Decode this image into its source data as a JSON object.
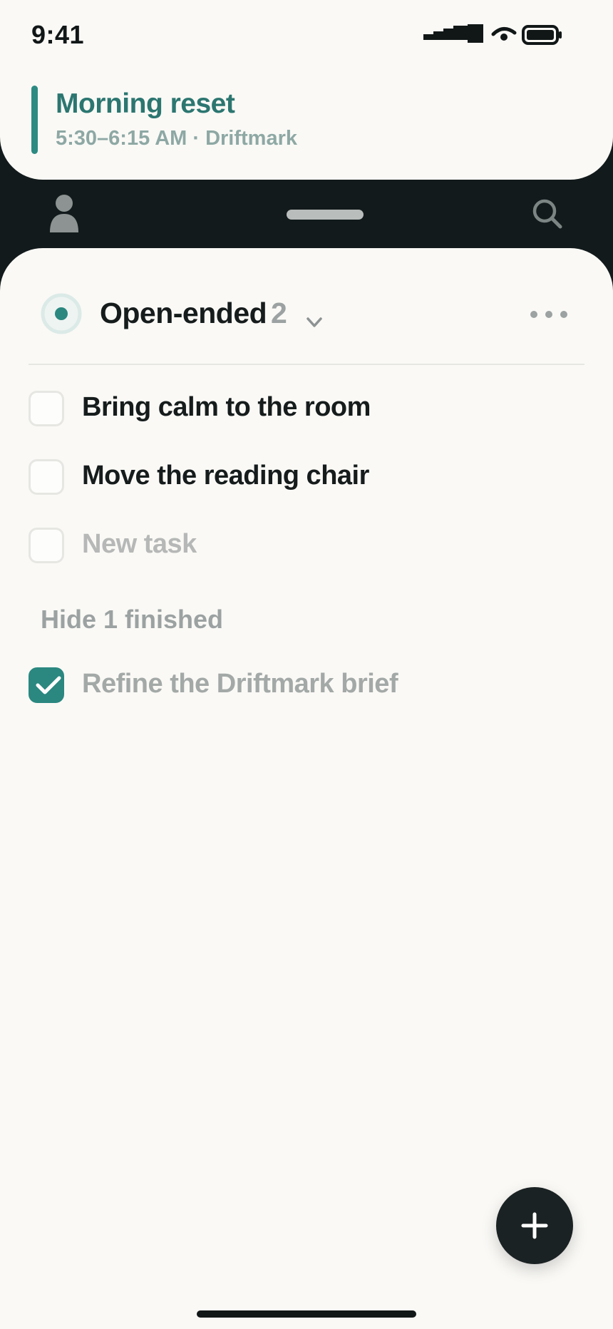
{
  "status_bar": {
    "time": "9:41",
    "icons": [
      "signal-icon",
      "wifi-icon",
      "battery-icon"
    ]
  },
  "event": {
    "title": "Morning reset",
    "subtitle": "5:30–6:15 AM · Driftmark",
    "accent_color": "#2d8a82"
  },
  "toolbar": {
    "left_icon": "profile-icon",
    "right_icon": "search-icon"
  },
  "list": {
    "title": "Open-ended",
    "count": "2",
    "status_icon": "radio-selected-icon",
    "chevron_icon": "chevron-down-icon",
    "more_icon": "more-horizontal-icon"
  },
  "tasks": [
    {
      "label": "Bring calm to the room",
      "done": false
    },
    {
      "label": "Move the reading chair",
      "done": false
    }
  ],
  "new_task": {
    "placeholder": "New task"
  },
  "finished": {
    "toggle_label": "Hide 1 finished",
    "items": [
      {
        "label": "Refine the Driftmark brief",
        "done": true
      }
    ]
  },
  "fab": {
    "icon": "plus-icon"
  },
  "colors": {
    "accent": "#2a8880",
    "dark": "#121a1b",
    "sheet": "#faf9f6"
  }
}
